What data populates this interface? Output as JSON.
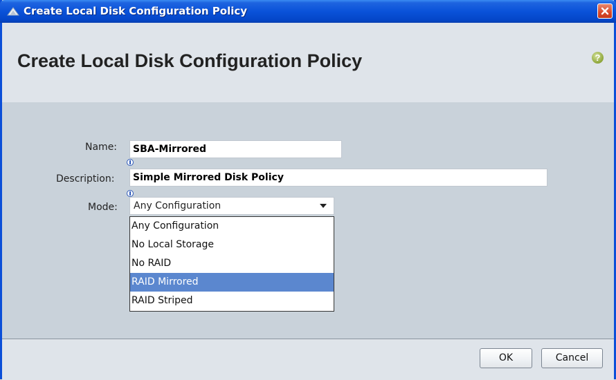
{
  "window": {
    "title": "Create Local Disk Configuration Policy",
    "title_icon": "cisco-ucs-icon",
    "close_icon": "close-icon"
  },
  "header": {
    "heading": "Create Local Disk Configuration Policy",
    "help_icon": "help-icon",
    "help_glyph": "?"
  },
  "form": {
    "name_label": "Name:",
    "name_value": "SBA-Mirrored",
    "description_label": "Description:",
    "description_value": "Simple Mirrored Disk Policy",
    "mode_label": "Mode:",
    "mode_value": "Any Configuration",
    "mode_options": [
      "Any Configuration",
      "No Local Storage",
      "No RAID",
      "RAID Mirrored",
      "RAID Striped"
    ],
    "highlighted_option": "RAID Mirrored"
  },
  "footer": {
    "ok_label": "OK",
    "cancel_label": "Cancel"
  },
  "colors": {
    "titlebar": "#0a52d9",
    "highlight": "#5b87cf",
    "help_icon": "#8ea63a"
  }
}
